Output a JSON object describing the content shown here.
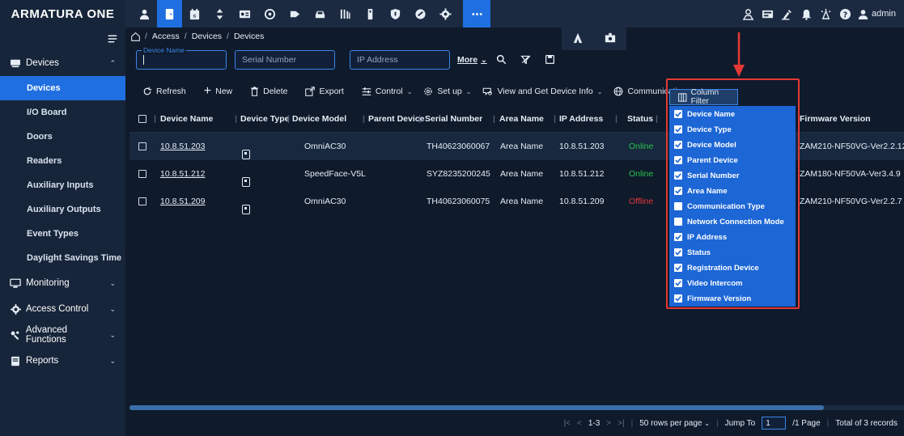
{
  "app": {
    "logo": "ARMATURA ONE",
    "user": "admin"
  },
  "topnav": {
    "icons": [
      "personnel-icon",
      "access-icon",
      "attendance-icon",
      "elevator-icon",
      "visitor-icon",
      "patrol-icon",
      "parking-icon",
      "vehicle-icon",
      "consumer-icon",
      "intrusion-icon",
      "locker-icon",
      "security-icon",
      "video-icon",
      "system-icon",
      "more-icon"
    ],
    "more_menu_icons": [
      "armatura-icon",
      "lobby-icon"
    ],
    "right_icons": [
      "guard-icon",
      "monitor-icon",
      "alert-icon",
      "bell-icon",
      "broadcast-icon",
      "help-icon"
    ]
  },
  "sidebar": {
    "groups": [
      {
        "label": "Devices",
        "expanded": true,
        "items": [
          "Devices",
          "I/O Board",
          "Doors",
          "Readers",
          "Auxiliary Inputs",
          "Auxiliary Outputs",
          "Event Types",
          "Daylight Savings Time"
        ]
      },
      {
        "label": "Monitoring"
      },
      {
        "label": "Access Control"
      },
      {
        "label": "Advanced Functions"
      },
      {
        "label": "Reports"
      }
    ],
    "active_item": "Devices"
  },
  "breadcrumb": [
    "Access",
    "Devices",
    "Devices"
  ],
  "search": {
    "device_name_legend": "Device Name",
    "device_name_value": "",
    "serial_placeholder": "Serial Number",
    "ip_placeholder": "IP Address",
    "more_label": "More"
  },
  "toolbar": {
    "refresh": "Refresh",
    "new": "New",
    "delete": "Delete",
    "export": "Export",
    "control": "Control",
    "setup": "Set up",
    "view_info": "View and Get Device Info",
    "communication": "Communication"
  },
  "table": {
    "headers": {
      "device_name": "Device Name",
      "device_type": "Device Type",
      "device_model": "Device Model",
      "parent_device": "Parent Device",
      "serial_number": "Serial Number",
      "area_name": "Area Name",
      "ip_address": "IP Address",
      "status": "Status",
      "firmware": "Firmware Version"
    },
    "rows": [
      {
        "device_name": "10.8.51.203",
        "device_model": "OmniAC30",
        "serial_number": "TH40623060067",
        "area_name": "Area Name",
        "ip_address": "10.8.51.203",
        "status": "Online",
        "firmware": "ZAM210-NF50VG-Ver2.2.12"
      },
      {
        "device_name": "10.8.51.212",
        "device_model": "SpeedFace-V5L",
        "serial_number": "SYZ8235200245",
        "area_name": "Area Name",
        "ip_address": "10.8.51.212",
        "status": "Online",
        "firmware": "ZAM180-NF50VA-Ver3.4.9"
      },
      {
        "device_name": "10.8.51.209",
        "device_model": "OmniAC30",
        "serial_number": "TH40623060075",
        "area_name": "Area Name",
        "ip_address": "10.8.51.209",
        "status": "Offline",
        "firmware": "ZAM210-NF50VG-Ver2.2.7"
      }
    ]
  },
  "column_filter": {
    "button_label": "Column Filter",
    "items": [
      {
        "label": "Device Name",
        "checked": true
      },
      {
        "label": "Device Type",
        "checked": true
      },
      {
        "label": "Device Model",
        "checked": true
      },
      {
        "label": "Parent Device",
        "checked": true
      },
      {
        "label": "Serial Number",
        "checked": true
      },
      {
        "label": "Area Name",
        "checked": true
      },
      {
        "label": "Communication Type",
        "checked": false
      },
      {
        "label": "Network Connection Mode",
        "checked": false
      },
      {
        "label": "IP Address",
        "checked": true
      },
      {
        "label": "Status",
        "checked": true
      },
      {
        "label": "Registration Device",
        "checked": true
      },
      {
        "label": "Video Intercom",
        "checked": true
      },
      {
        "label": "Firmware Version",
        "checked": true
      }
    ]
  },
  "pagination": {
    "range": "1-3",
    "rows_per_page": "50 rows per page",
    "jump_label": "Jump To",
    "jump_value": "1",
    "page_total": "/1 Page",
    "records": "Total of 3 records"
  },
  "colors": {
    "accent": "#1f6fe0",
    "online": "#27c24c",
    "offline": "#e5383b",
    "highlight": "#e53935"
  }
}
